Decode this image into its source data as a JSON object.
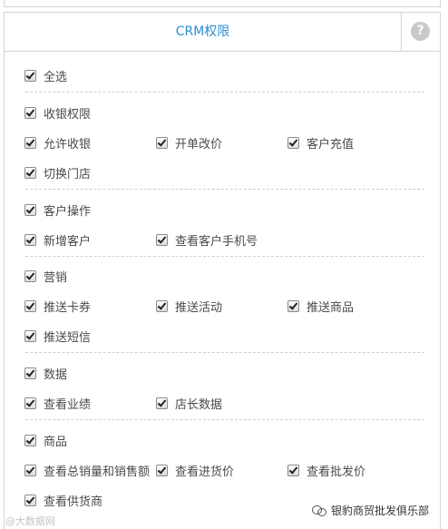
{
  "panel": {
    "title": "CRM权限",
    "help_symbol": "?"
  },
  "select_all": {
    "label": "全选",
    "checked": true
  },
  "groups": [
    {
      "id": "cashier",
      "label": "收银权限",
      "items": [
        {
          "label": "允许收银",
          "checked": true
        },
        {
          "label": "开单改价",
          "checked": true
        },
        {
          "label": "客户充值",
          "checked": true
        },
        {
          "label": "切换门店",
          "checked": true
        }
      ]
    },
    {
      "id": "customer",
      "label": "客户操作",
      "items": [
        {
          "label": "新增客户",
          "checked": true
        },
        {
          "label": "查看客户手机号",
          "checked": true
        }
      ]
    },
    {
      "id": "marketing",
      "label": "营销",
      "items": [
        {
          "label": "推送卡券",
          "checked": true
        },
        {
          "label": "推送活动",
          "checked": true
        },
        {
          "label": "推送商品",
          "checked": true
        },
        {
          "label": "推送短信",
          "checked": true
        }
      ]
    },
    {
      "id": "data",
      "label": "数据",
      "items": [
        {
          "label": "查看业绩",
          "checked": true
        },
        {
          "label": "店长数据",
          "checked": true
        }
      ]
    },
    {
      "id": "goods",
      "label": "商品",
      "items": [
        {
          "label": "查看总销量和销售额",
          "checked": true
        },
        {
          "label": "查看进货价",
          "checked": true
        },
        {
          "label": "查看批发价",
          "checked": true
        },
        {
          "label": "查看供货商",
          "checked": true
        }
      ]
    }
  ],
  "watermarks": {
    "left": "@大数据网",
    "right": "银豹商贸批发俱乐部"
  }
}
